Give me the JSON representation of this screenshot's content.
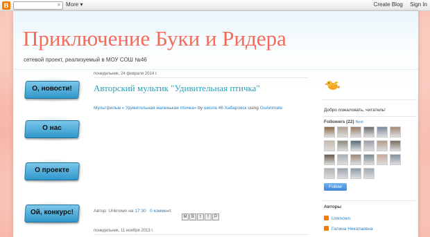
{
  "navbar": {
    "logo": "B",
    "search_icon": "search-icon",
    "more_label": "More ▾",
    "create_blog": "Create Blog",
    "sign_in": "Sign In"
  },
  "header": {
    "title": "Приключение Буки и Ридера",
    "description": "сетевой проект, реализуемый в МОУ СОШ №46"
  },
  "menu": [
    {
      "label": "О, новости!"
    },
    {
      "label": "О нас"
    },
    {
      "label": "О проекте"
    },
    {
      "label": "Ой, конкурс!"
    }
  ],
  "posts": [
    {
      "date": "понедельник, 24 февраля 2014 г.",
      "title": "Авторский мультик \"Удивительная птичка\"",
      "body_link": "Мультфильм « Удивительная маленькая птичка»",
      "body_by": " by ",
      "body_author": "школа 46 Хабаровск",
      "body_using": " using ",
      "body_tool": "GoAnimate",
      "footer_author_label": "Автор: Unknown на ",
      "footer_time": "17:30",
      "footer_comments": "0 коммент.",
      "share_icons": [
        "M",
        "B",
        "t",
        "f",
        "P"
      ]
    },
    {
      "date": "понедельник, 11 ноября 2013 г."
    }
  ],
  "sidebar": {
    "welcome": "Добро пожаловать, читатель!",
    "followers_label": "Followers (22)",
    "followers_new": "Next",
    "follow_button": "Follow",
    "authors_label": "Авторы",
    "authors": [
      "Unknown",
      "Галина Николаевна"
    ],
    "avatar_colors": [
      "#8a6a4a",
      "#b0a090",
      "#9a7b66",
      "#6d6d6d",
      "#7a8a9a",
      "#a48a7a",
      "#c9b9a9",
      "#8a8a80",
      "#5a6a7a",
      "#9aa0a8",
      "#b89a88",
      "#7b6b5b",
      "#6a5a4a",
      "#a8b0b8",
      "#9a8878",
      "#7a8a90",
      "#c8a898",
      "#8090a0",
      "#b0b0b0",
      "#9aa4ae",
      "#8a9aaa",
      "#a0a8b0"
    ]
  }
}
